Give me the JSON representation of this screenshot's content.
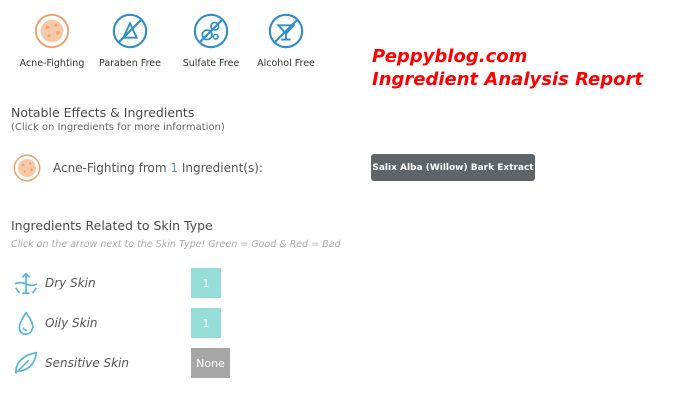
{
  "badges": [
    {
      "label": "Acne-Fighting",
      "icon": "acne-icon",
      "color": "#f0a06a"
    },
    {
      "label": "Paraben Free",
      "icon": "paraben-free-icon",
      "color": "#2d8ec8"
    },
    {
      "label": "Sulfate Free",
      "icon": "sulfate-free-icon",
      "color": "#2d8ec8"
    },
    {
      "label": "Alcohol Free",
      "icon": "alcohol-free-icon",
      "color": "#2d8ec8"
    }
  ],
  "brand": {
    "line1": "Peppyblog.com",
    "line2": "Ingredient Analysis Report",
    "color": "#ff0000"
  },
  "notable": {
    "title": "Notable Effects & Ingredients",
    "subtitle": "(Click on Ingredients for more information)",
    "effect": {
      "name": "Acne-Fighting",
      "from_text": "from",
      "count": "1",
      "suffix": "Ingredient(s):",
      "ingredient": "Salix Alba (Willow) Bark Extract"
    }
  },
  "skin": {
    "title": "Ingredients Related to Skin Type",
    "hint": "Click on the arrow next to the Skin Type! Green = Good & Red = Bad",
    "rows": [
      {
        "name": "Dry Skin",
        "value": "1",
        "icon": "dry-skin-icon"
      },
      {
        "name": "Oily Skin",
        "value": "1",
        "icon": "oily-skin-icon"
      },
      {
        "name": "Sensitive Skin",
        "value": "None",
        "icon": "sensitive-skin-icon"
      }
    ]
  },
  "colors": {
    "teal": "#95ddd8",
    "gray": "#a6a6a6",
    "blue_icon": "#2d8ec8",
    "orange_icon": "#f0a06a",
    "dark_button": "#5e6468"
  }
}
